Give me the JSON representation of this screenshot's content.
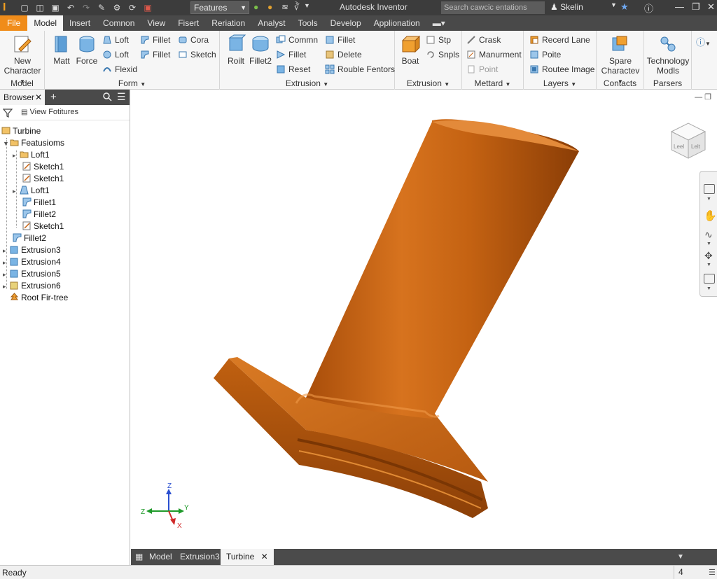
{
  "app": {
    "title": "Autodesk Inventor",
    "combo_value": "Features",
    "search_placeholder": "Search cawcic entations",
    "user": "Skelin"
  },
  "tabs": [
    "File",
    "Model",
    "Insert",
    "Comnon",
    "View",
    "Fisert",
    "Reriation",
    "Analyst",
    "Tools",
    "Develop",
    "Applionation"
  ],
  "active_tab": "Model",
  "ribbon": {
    "model_panel": {
      "title": "Model",
      "new_character": "New\nCharacter"
    },
    "form_panel": {
      "title": "Form",
      "matt": "Matt",
      "force": "Force",
      "loft1": "Loft",
      "loft2": "Loft",
      "flexid": "Flexid",
      "fillet1": "Fillet",
      "fillet2": "Fillet",
      "cora": "Cora",
      "sketch": "Sketch"
    },
    "extrusion_panel": {
      "title": "Extrusion",
      "roilt": "Roilt",
      "fillet2": "Fillet2",
      "commn": "Commn",
      "fillet": "Fillet",
      "reset": "Reset",
      "fillet_b": "Fillet",
      "delete": "Delete",
      "rouble_fentors": "Rouble Fentors"
    },
    "extrusion2_panel": {
      "title": "Extrusion",
      "boat": "Boat",
      "stp": "Stp",
      "snpls": "Snpls"
    },
    "mettard_panel": {
      "title": "Mettard",
      "crask": "Crask",
      "manurment": "Manurment",
      "point": "Point"
    },
    "layers_panel": {
      "title": "Layers",
      "recerd_lane": "Recerd Lane",
      "poite": "Poite",
      "routee_image": "Routee Image"
    },
    "contacts_panel": {
      "title": "Contacts",
      "spare": "Spare\nCharactev"
    },
    "parsers_panel": {
      "title": "Parsers",
      "technology": "Technology\nModls"
    }
  },
  "browser": {
    "tab_label": "Browser",
    "view_features": "View Fotitures",
    "tree": [
      {
        "label": "Turbine"
      },
      {
        "label": "Featusioms"
      },
      {
        "label": "Loft1"
      },
      {
        "label": "Sketch1"
      },
      {
        "label": "Sketch1"
      },
      {
        "label": "Loft1"
      },
      {
        "label": "Fillet1"
      },
      {
        "label": "Fillet2"
      },
      {
        "label": "Sketch1"
      },
      {
        "label": "Fillet2"
      },
      {
        "label": "Extrusion3"
      },
      {
        "label": "Extrusion4"
      },
      {
        "label": "Extrusion5"
      },
      {
        "label": "Extrusion6"
      },
      {
        "label": "Root Fir-tree"
      }
    ]
  },
  "viewport": {
    "part_color": "#c86414",
    "viewcube_left": "Leel",
    "viewcube_right": "Lelt",
    "triad": {
      "z": "Z",
      "x": "X",
      "y": "Y",
      "zneg": "Z"
    }
  },
  "doc_tabs": {
    "model": "Model",
    "extrusion": "Extrusion3",
    "turbine": "Turbine"
  },
  "status": {
    "text": "Ready",
    "count": "4"
  },
  "colors": {
    "file_tab": "#f08c1a",
    "accent_orange": "#c86414",
    "dark_bg": "#3c3c3c"
  }
}
